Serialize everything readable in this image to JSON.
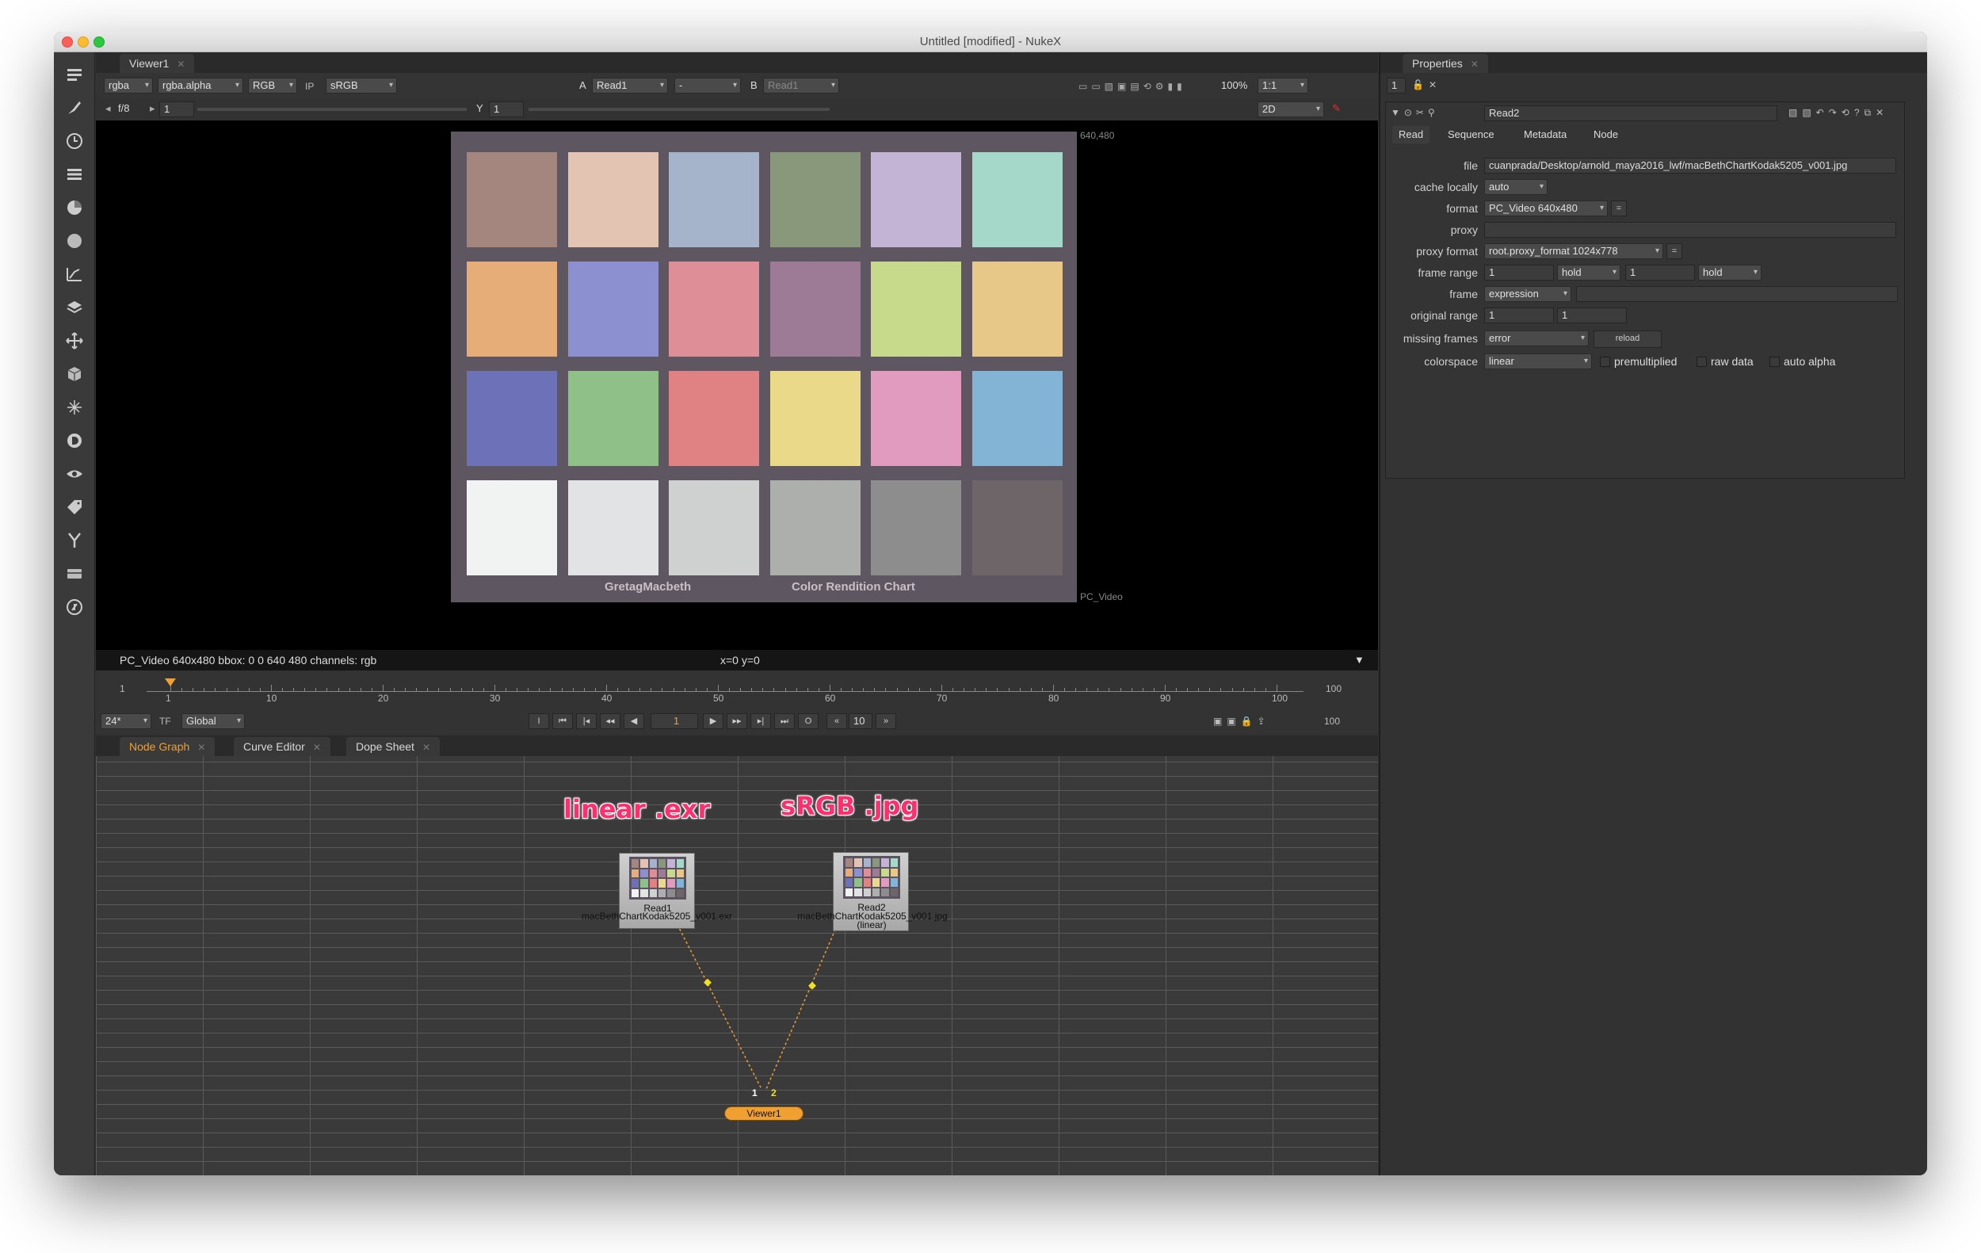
{
  "window": {
    "title": "Untitled [modified] - NukeX"
  },
  "toolbar": {
    "icons": [
      "panel-menu-icon",
      "brush-icon",
      "clock-icon",
      "list-icon",
      "color-wheel-icon",
      "circle-icon",
      "channel-graph-icon",
      "layers-icon",
      "move-icon",
      "cube-icon",
      "particles-icon",
      "deep-icon",
      "eye-icon",
      "tag-icon",
      "tools-icon",
      "stack-icon",
      "plugin-icon"
    ]
  },
  "viewer": {
    "tab_label": "Viewer1",
    "channels": "rgba",
    "alpha_channel": "rgba.alpha",
    "display": "RGB",
    "ip_label": "IP",
    "lut": "sRGB",
    "a_label": "A",
    "a_input": "Read1",
    "op": "-",
    "b_label": "B",
    "b_input": "Read1",
    "zoom": "100%",
    "ratio": "1:1",
    "fstop": "f/8",
    "gain": "1",
    "gamma_label": "Y",
    "gamma": "1",
    "mode": "2D",
    "format_corner": "640,480",
    "format_label": "PC_Video",
    "chart_left_text": "GretagMacbeth",
    "chart_right_text": "Color Rendition Chart",
    "status_info": "PC_Video 640x480  bbox: 0 0 640 480 channels: rgb",
    "status_coords": "x=0 y=0"
  },
  "macbeth_patches": [
    "#a5867e",
    "#e3c4b2",
    "#a6b4cb",
    "#89977a",
    "#c3b4d6",
    "#a6d8ca",
    "#e7ad79",
    "#8c8fd0",
    "#de8e96",
    "#9d7b96",
    "#c7d98a",
    "#e8c888",
    "#6c71b8",
    "#8fc087",
    "#e08183",
    "#ebd98a",
    "#e19bbf",
    "#83b4d6",
    "#f1f2f2",
    "#e2e3e5",
    "#cfd1d0",
    "#adafac",
    "#8e8d8e",
    "#6e6569"
  ],
  "timeline": {
    "start": "1",
    "end": "100",
    "marks": [
      "1",
      "10",
      "20",
      "30",
      "40",
      "50",
      "60",
      "70",
      "80",
      "90",
      "100"
    ],
    "fps": "24*",
    "tf": "TF",
    "scope": "Global",
    "frame": "1",
    "step": "10",
    "out_frame": "100",
    "in_btn": "I",
    "out_btn": "O"
  },
  "nodegraph": {
    "tabs": [
      {
        "label": "Node Graph"
      },
      {
        "label": "Curve Editor"
      },
      {
        "label": "Dope Sheet"
      }
    ],
    "annotation_left": "linear .exr",
    "annotation_right": "sRGB .jpg",
    "read1_name": "Read1",
    "read1_file": "macBethChartKodak5205_v001.exr",
    "read2_name": "Read2",
    "read2_file": "macBethChartKodak5205_v001.jpg",
    "read2_cs": "(linear)",
    "viewer_name": "Viewer1",
    "pipe1": "1",
    "pipe2": "2"
  },
  "properties": {
    "tab_label": "Properties",
    "max_panels": "1",
    "node_name": "Read2",
    "node_tabs": [
      "Read",
      "Sequence",
      "Metadata",
      "Node"
    ],
    "file_label": "file",
    "file_value": "cuanprada/Desktop/arnold_maya2016_lwf/macBethChartKodak5205_v001.jpg",
    "cache_label": "cache locally",
    "cache_value": "auto",
    "format_label": "format",
    "format_value": "PC_Video 640x480",
    "proxy_label": "proxy",
    "proxy_value": "",
    "proxy_format_label": "proxy format",
    "proxy_format_value": "root.proxy_format 1024x778",
    "frame_range_label": "frame range",
    "frame_range_first": "1",
    "frame_range_before": "hold",
    "frame_range_last": "1",
    "frame_range_after": "hold",
    "frame_label": "frame",
    "frame_mode": "expression",
    "original_range_label": "original range",
    "orig_first": "1",
    "orig_last": "1",
    "missing_label": "missing frames",
    "missing_value": "error",
    "reload_label": "reload",
    "colorspace_label": "colorspace",
    "colorspace_value": "linear",
    "premult_label": "premultiplied",
    "raw_label": "raw data",
    "auto_alpha_label": "auto alpha",
    "equal_btn": "="
  }
}
